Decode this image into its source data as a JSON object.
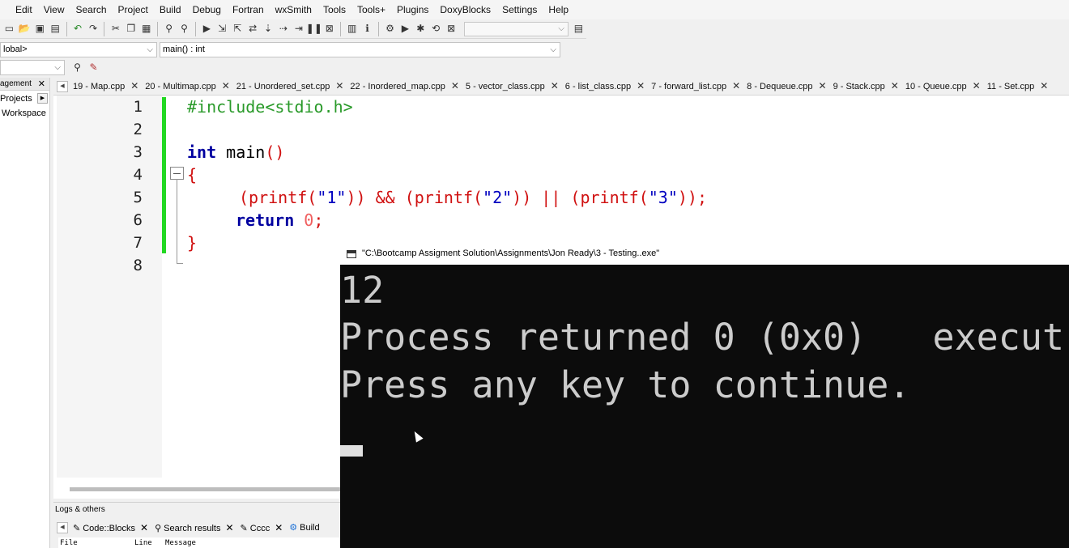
{
  "menu": [
    "Edit",
    "View",
    "Search",
    "Project",
    "Build",
    "Debug",
    "Fortran",
    "wxSmith",
    "Tools",
    "Tools+",
    "Plugins",
    "DoxyBlocks",
    "Settings",
    "Help"
  ],
  "toolbar": {
    "icons": [
      "new-file",
      "open",
      "save",
      "save-all",
      "undo",
      "redo",
      "cut",
      "copy",
      "paste",
      "find",
      "replace",
      "run",
      "step-into",
      "step-over",
      "step-out",
      "next-line",
      "run-to-cursor",
      "break",
      "pause",
      "stop",
      "debug-windows",
      "info",
      "settings",
      "play",
      "build",
      "rebuild",
      "abort"
    ]
  },
  "scope": {
    "global": "lobal>",
    "function": "main() : int"
  },
  "left_panel": {
    "header": "agement",
    "close": "✕",
    "tab": "Projects",
    "item": "Workspace"
  },
  "tabs": [
    {
      "label": "19 - Map.cpp"
    },
    {
      "label": "20 - Multimap.cpp"
    },
    {
      "label": "21 - Unordered_set.cpp"
    },
    {
      "label": "22 - Inordered_map.cpp"
    },
    {
      "label": "5 - vector_class.cpp"
    },
    {
      "label": "6 - list_class.cpp"
    },
    {
      "label": "7 - forward_list.cpp"
    },
    {
      "label": "8 - Dequeue.cpp"
    },
    {
      "label": "9 - Stack.cpp"
    },
    {
      "label": "10 - Queue.cpp"
    },
    {
      "label": "11 - Set.cpp"
    }
  ],
  "code": {
    "line_numbers": [
      "1",
      "2",
      "3",
      "4",
      "5",
      "6",
      "7",
      "8"
    ],
    "l1": "#include<stdio.h>",
    "l3_kw": "int",
    "l3_id": " main",
    "l3_p": "()",
    "l4": "{",
    "l5_a": "(printf(",
    "l5_s1": "\"1\"",
    "l5_b": ")) && (printf(",
    "l5_s2": "\"2\"",
    "l5_c": ")) || (printf(",
    "l5_s3": "\"3\"",
    "l5_d": "));",
    "l6_kw": "return",
    "l6_num": " 0",
    "l6_p": ";",
    "l7": "}"
  },
  "logs": {
    "title": "Logs & others",
    "tabs": [
      {
        "label": "Code::Blocks"
      },
      {
        "label": "Search results"
      },
      {
        "label": "Cccc"
      },
      {
        "label": "Build"
      }
    ],
    "columns": [
      "File",
      "Line",
      "Message"
    ]
  },
  "console": {
    "title": "\"C:\\Bootcamp Assigment Solution\\Assignments\\Jon Ready\\3 - Testing..exe\"",
    "output_line1": "12",
    "output_line2": "Process returned 0 (0x0)   execut",
    "output_line3": "Press any key to continue."
  },
  "colors": {
    "change_bar": "#22d822",
    "console_bg": "#0c0c0c",
    "console_fg": "#cccccc"
  }
}
